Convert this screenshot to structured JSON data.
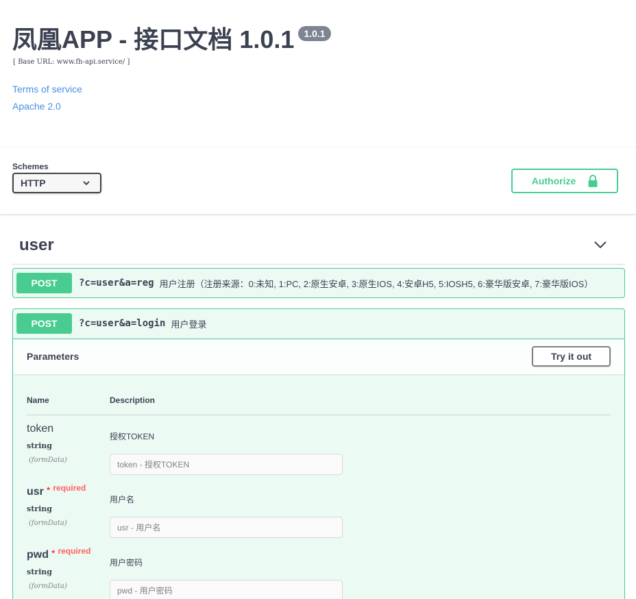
{
  "info": {
    "title": "凤凰APP - 接口文档 1.0.1",
    "version": "1.0.1",
    "base_url": "[ Base URL: www.fh-api.service/ ]",
    "terms_link": "Terms of service",
    "license_link": "Apache 2.0"
  },
  "schemes": {
    "label": "Schemes",
    "selected": "HTTP",
    "chevron_icon": "chevron-down-icon"
  },
  "authorize": {
    "label": "Authorize",
    "icon": "lock-icon"
  },
  "tag": {
    "name": "user",
    "icon": "chevron-down-icon"
  },
  "operations": [
    {
      "method": "POST",
      "path": "?c=user&a=reg",
      "summary": "用户注册（注册来源：0:未知, 1:PC, 2:原生安卓, 3:原生IOS, 4:安卓H5, 5:IOSH5, 6:豪华版安卓, 7:豪华版IOS）"
    },
    {
      "method": "POST",
      "path": "?c=user&a=login",
      "summary": "用户登录",
      "parameters_title": "Parameters",
      "try_it_out": "Try it out",
      "columns": {
        "name": "Name",
        "description": "Description"
      },
      "params": [
        {
          "name": "token",
          "required": false,
          "required_label": "",
          "type": "string",
          "in": "(formData)",
          "description": "授权TOKEN",
          "placeholder": "token - 授权TOKEN"
        },
        {
          "name": "usr",
          "required": true,
          "required_label": "required",
          "type": "string",
          "in": "(formData)",
          "description": "用户名",
          "placeholder": "usr - 用户名"
        },
        {
          "name": "pwd",
          "required": true,
          "required_label": "required",
          "type": "string",
          "in": "(formData)",
          "description": "用户密码",
          "placeholder": "pwd - 用户密码"
        }
      ]
    }
  ],
  "colors": {
    "post": "#49cc90",
    "link": "#4990e2",
    "text": "#3b4151",
    "badge": "#7d8492",
    "required": "#ff6060"
  }
}
